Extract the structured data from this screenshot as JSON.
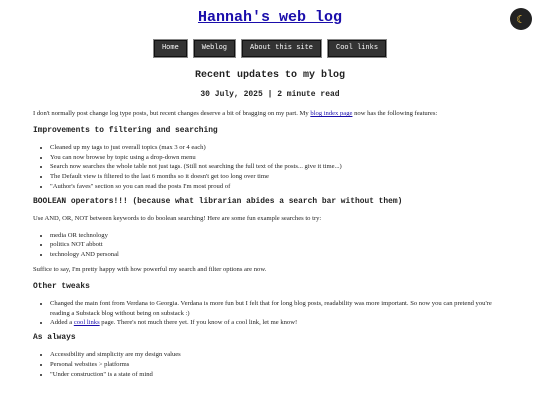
{
  "site": {
    "title": "Hannah's web log",
    "theme_icon": "moon-icon"
  },
  "nav": [
    {
      "label": "Home"
    },
    {
      "label": "Weblog"
    },
    {
      "label": "About this site"
    },
    {
      "label": "Cool links"
    }
  ],
  "post": {
    "title": "Recent updates to my blog",
    "meta": "30 July, 2025 | 2 minute read",
    "intro": {
      "before": "I don't normally post change log type posts, but recent changes deserve a bit of bragging on my part. My ",
      "link": "blog index page",
      "after": " now has the following features:"
    },
    "sections": {
      "filtering": {
        "heading": "Improvements to filtering and searching",
        "items": [
          "Cleaned up my tags to just overall topics (max 3 or 4 each)",
          "You can now browse by topic using a drop-down menu",
          "Search now searches the whole table not just tags. (Still not searching the full text of the posts... give it time...)",
          "The Default view is filtered to the last 6 months so it doesn't get too long over time",
          "\"Author's faves\" section so you can read the posts I'm most proud of"
        ]
      },
      "boolean": {
        "heading": "BOOLEAN operators!!! (because what librarian abides a search bar without them)",
        "text": "Use AND, OR, NOT between keywords to do boolean searching! Here are some fun example searches to try:",
        "items": [
          "media OR technology",
          "politics NOT abbott",
          "technology AND personal"
        ],
        "outro": "Suffice to say, I'm pretty happy with how powerful my search and filter options are now."
      },
      "tweaks": {
        "heading": "Other tweaks",
        "item1": "Changed the main font from Verdana to Georgia. Verdana is more fun but I felt that for long blog posts, readability was more important. So now you can pretend you're reading a Substack blog without being on substack :)",
        "item2": {
          "before": "Added a ",
          "link": "cool links",
          "after": " page. There's not much there yet. If you know of a cool link, let me know!"
        }
      },
      "always": {
        "heading": "As always",
        "items": [
          "Accessibility and simplicity are my design values",
          "Personal websites > platforms",
          "\"Under construction\" is a state of mind"
        ]
      }
    }
  }
}
